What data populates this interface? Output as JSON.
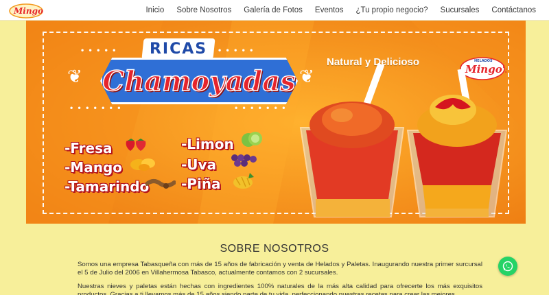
{
  "brand": {
    "logo_text": "Mingo's",
    "logo_sub": "HELADOS"
  },
  "nav": {
    "items": [
      {
        "label": "Inicio"
      },
      {
        "label": "Sobre Nosotros"
      },
      {
        "label": "Galería de Fotos"
      },
      {
        "label": "Eventos"
      },
      {
        "label": "¿Tu propio negocio?"
      },
      {
        "label": "Sucursales"
      },
      {
        "label": "Contáctanos"
      }
    ]
  },
  "banner": {
    "ricas": "RICAS",
    "headline": "Chamoyadas",
    "tagline": "Natural y Delicioso",
    "flavors": [
      "-Fresa",
      "-Mango",
      "-Tamarindo",
      "-Limon",
      "-Uva",
      "-Piña"
    ]
  },
  "about": {
    "title": "SOBRE NOSOTROS",
    "paragraph_1": "Somos una empresa Tabasqueña con más de 15 años de fabricación y venta de Helados y Paletas. Inaugurando nuestra primer surcursal el 5 de Julio del 2006 en Villahermosa Tabasco, actualmente contamos con 2 sucursales.",
    "paragraph_2": "Nuestras nieves y paletas están hechas con ingredientes 100% naturales de la más alta calidad para ofrecerte los más exquisitos productos. Gracias a ti llevamos más de 15 años siendo parte de tu vida, perfeccionando nuestras recetas para crear las mejores"
  },
  "colors": {
    "accent_yellow": "#f7ef9a",
    "banner_orange": "#f39a1e",
    "whatsapp": "#25d366"
  },
  "icons": {
    "whatsapp": "whatsapp-icon"
  }
}
